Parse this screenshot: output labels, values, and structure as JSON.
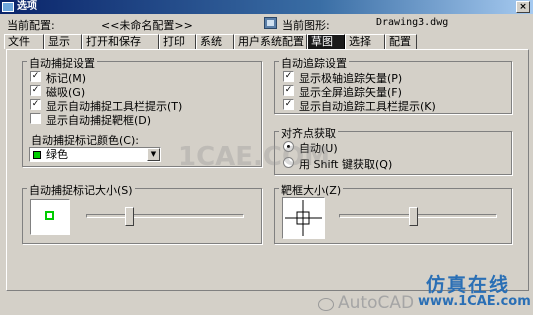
{
  "window": {
    "title": "选项",
    "close_label": "×"
  },
  "header": {
    "profile_label": "当前配置:",
    "profile_value": "<<未命名配置>>",
    "drawing_label": "当前图形:",
    "drawing_value": "Drawing3.dwg"
  },
  "tabs": [
    {
      "label": "文件",
      "active": false
    },
    {
      "label": "显示",
      "active": false
    },
    {
      "label": "打开和保存",
      "active": false
    },
    {
      "label": "打印",
      "active": false
    },
    {
      "label": "系统",
      "active": false
    },
    {
      "label": "用户系统配置",
      "active": false
    },
    {
      "label": "草图",
      "active": true
    },
    {
      "label": "选择",
      "active": false
    },
    {
      "label": "配置",
      "active": false
    }
  ],
  "autosnap": {
    "title": "自动捕捉设置",
    "items": [
      {
        "label": "标记(M)",
        "checked": true
      },
      {
        "label": "磁吸(G)",
        "checked": true
      },
      {
        "label": "显示自动捕捉工具栏提示(T)",
        "checked": true
      },
      {
        "label": "显示自动捕捉靶框(D)",
        "checked": false
      }
    ],
    "color_label": "自动捕捉标记颜色(C):",
    "color_value": "绿色",
    "color_swatch": "#00cc00"
  },
  "autotrack": {
    "title": "自动追踪设置",
    "items": [
      {
        "label": "显示极轴追踪矢量(P)",
        "checked": true
      },
      {
        "label": "显示全屏追踪矢量(F)",
        "checked": true
      },
      {
        "label": "显示自动追踪工具栏提示(K)",
        "checked": true
      }
    ]
  },
  "alignment": {
    "title": "对齐点获取",
    "options": [
      {
        "label": "自动(U)",
        "selected": true
      },
      {
        "label": "用 Shift 键获取(Q)",
        "selected": false
      }
    ]
  },
  "marker_size": {
    "title": "自动捕捉标记大小(S)",
    "level": 0.26
  },
  "aperture_size": {
    "title": "靶框大小(Z)",
    "level": 0.47
  },
  "watermark": {
    "center_text": "1CAE.COM",
    "bottom_left": "AutoCAD",
    "brand_cn": "仿真在线",
    "brand_url": "www.1CAE.com"
  },
  "colors": {
    "title_bar": "#0a246a",
    "face": "#d4d0c8",
    "marker": "#00cc00",
    "brand": "#2a6fb5"
  }
}
